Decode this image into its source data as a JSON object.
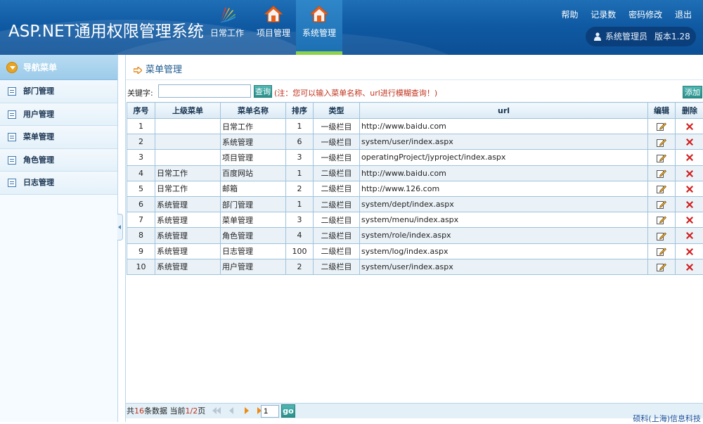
{
  "header": {
    "app_title": "ASP.NET通用权限管理系统",
    "nav_tabs": [
      {
        "label": "日常工作",
        "icon": "logo-fan-icon"
      },
      {
        "label": "项目管理",
        "icon": "house-icon"
      },
      {
        "label": "系统管理",
        "icon": "house-icon",
        "active": true
      }
    ],
    "top_links": [
      "帮助",
      "记录数",
      "密码修改",
      "退出"
    ],
    "user_name": "系统管理员",
    "version": "版本1.28"
  },
  "sidebar": {
    "title": "导航菜单",
    "items": [
      {
        "label": "部门管理",
        "icon": "list-icon"
      },
      {
        "label": "用户管理",
        "icon": "list-icon"
      },
      {
        "label": "菜单管理",
        "icon": "list-icon"
      },
      {
        "label": "角色管理",
        "icon": "list-icon"
      },
      {
        "label": "日志管理",
        "icon": "list-icon"
      }
    ]
  },
  "main": {
    "panel_title": "菜单管理",
    "search_label": "关键字:",
    "search_value": "",
    "search_button": "查询",
    "hint": "(注：您可以输入菜单名称、url进行模糊查询！)",
    "add_button": "添加",
    "columns": [
      "序号",
      "上级菜单",
      "菜单名称",
      "排序",
      "类型",
      "url",
      "编辑",
      "删除"
    ],
    "rows": [
      [
        "1",
        "",
        "日常工作",
        "1",
        "一级栏目",
        "http://www.baidu.com"
      ],
      [
        "2",
        "",
        "系统管理",
        "6",
        "一级栏目",
        "system/user/index.aspx"
      ],
      [
        "3",
        "",
        "项目管理",
        "3",
        "一级栏目",
        "operatingProject/jyproject/index.aspx"
      ],
      [
        "4",
        "日常工作",
        "百度网站",
        "1",
        "二级栏目",
        "http://www.baidu.com"
      ],
      [
        "5",
        "日常工作",
        "邮箱",
        "2",
        "二级栏目",
        "http://www.126.com"
      ],
      [
        "6",
        "系统管理",
        "部门管理",
        "1",
        "二级栏目",
        "system/dept/index.aspx"
      ],
      [
        "7",
        "系统管理",
        "菜单管理",
        "3",
        "二级栏目",
        "system/menu/index.aspx"
      ],
      [
        "8",
        "系统管理",
        "角色管理",
        "4",
        "二级栏目",
        "system/role/index.aspx"
      ],
      [
        "9",
        "系统管理",
        "日志管理",
        "100",
        "二级栏目",
        "system/log/index.aspx"
      ],
      [
        "10",
        "系统管理",
        "用户管理",
        "2",
        "二级栏目",
        "system/user/index.aspx"
      ]
    ]
  },
  "pager": {
    "prefix": "共",
    "total": "16",
    "mid": "条数据 当前",
    "current": "1/2",
    "suffix": "页",
    "page_input": "1",
    "go_label": "go"
  },
  "footer": "硕科(上海)信息科技",
  "colors": {
    "header_blue": "#0f5aa3",
    "active_tab_underline": "#8ed24a",
    "teal_button": "#2a908c",
    "hint_red": "#c0311b",
    "delete_red": "#d21e1e"
  }
}
